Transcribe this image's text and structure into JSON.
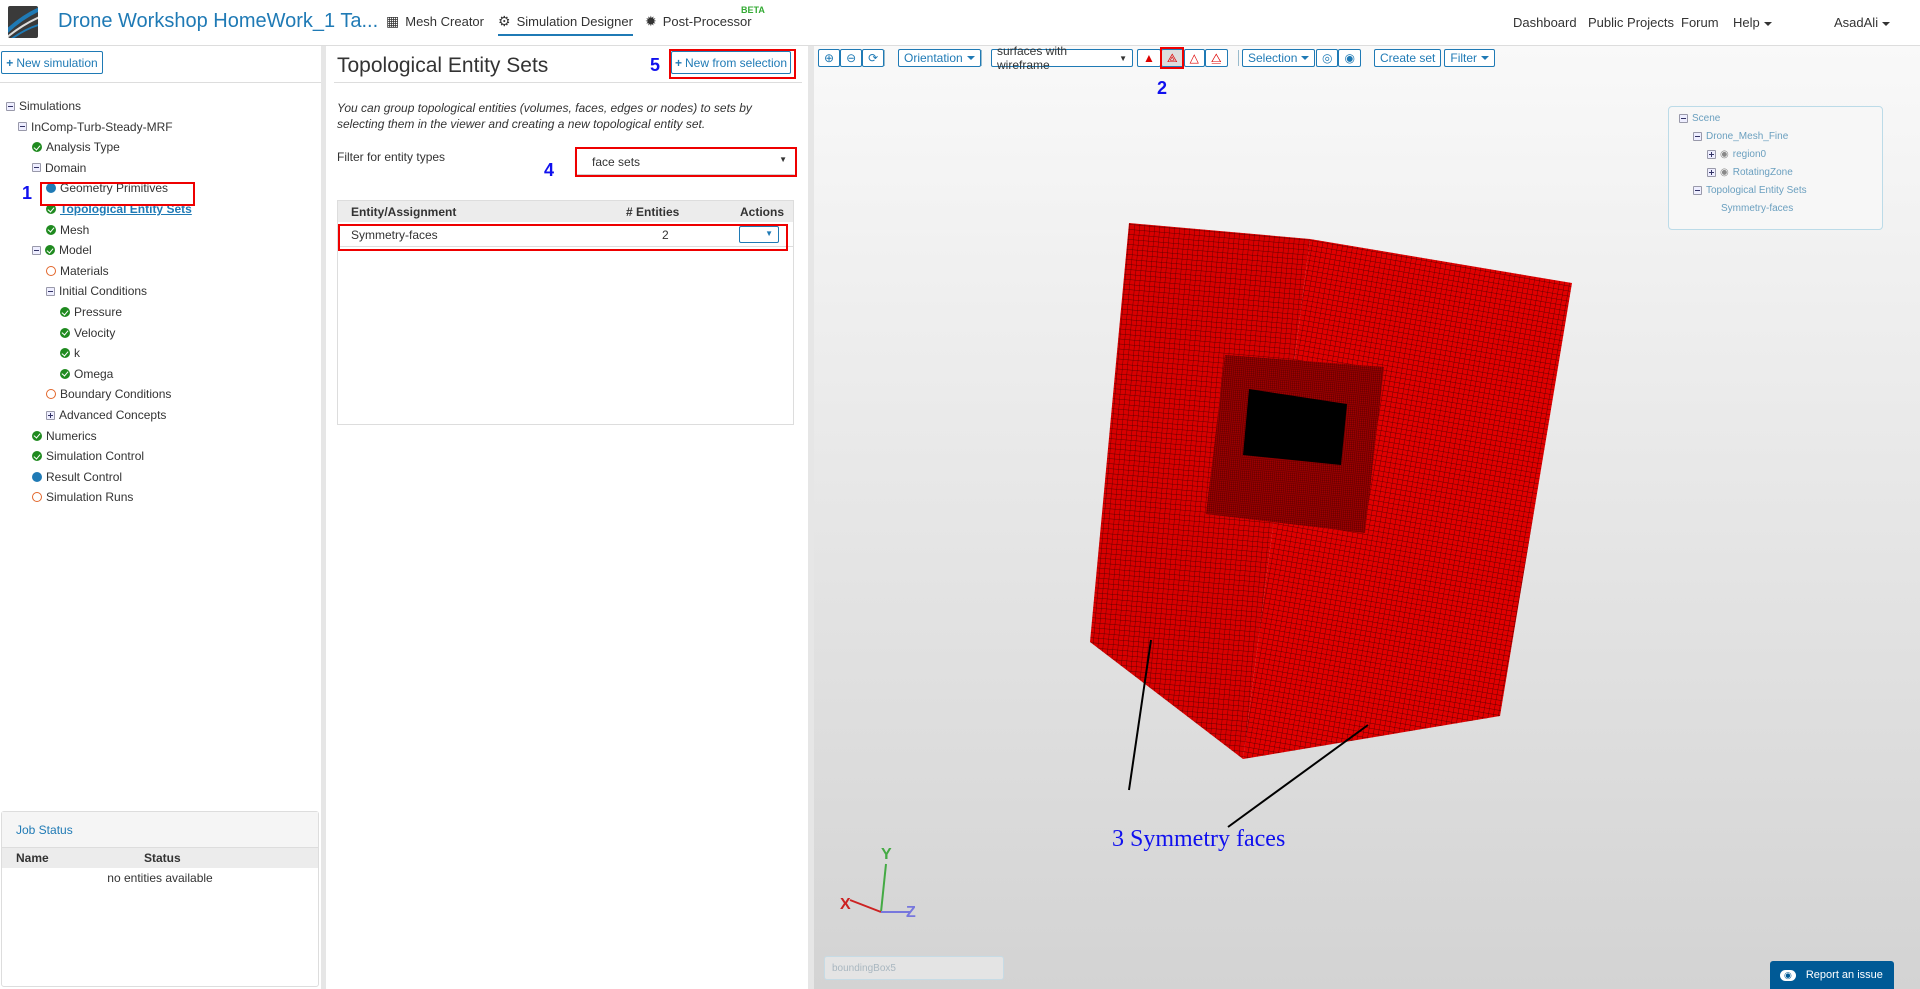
{
  "header": {
    "title": "Drone Workshop HomeWork_1 Ta...",
    "nav": [
      {
        "label": "Mesh Creator",
        "icon": "grid-icon"
      },
      {
        "label": "Simulation Designer",
        "icon": "gears-icon",
        "active": true
      },
      {
        "label": "Post-Processor",
        "icon": "gear-icon",
        "badge": "BETA"
      }
    ],
    "right_nav": [
      {
        "label": "Dashboard"
      },
      {
        "label": "Public Projects"
      },
      {
        "label": "Forum"
      },
      {
        "label": "Help"
      },
      {
        "label": "AsadAli"
      }
    ]
  },
  "sidebar": {
    "new_simulation": "New simulation",
    "tree": [
      {
        "label": "Simulations",
        "depth": 0,
        "icon": "minus"
      },
      {
        "label": "InComp-Turb-Steady-MRF",
        "depth": 1,
        "icon": "minus"
      },
      {
        "label": "Analysis Type",
        "depth": 2,
        "icon": "ok"
      },
      {
        "label": "Domain",
        "depth": 2,
        "icon": "minus"
      },
      {
        "label": "Geometry Primitives",
        "depth": 3,
        "icon": "info"
      },
      {
        "label": "Topological Entity Sets",
        "depth": 3,
        "icon": "ok",
        "selected": true
      },
      {
        "label": "Mesh",
        "depth": 3,
        "icon": "ok"
      },
      {
        "label": "Model",
        "depth": 2,
        "icon": "minus-ok"
      },
      {
        "label": "Materials",
        "depth": 3,
        "icon": "todo"
      },
      {
        "label": "Initial Conditions",
        "depth": 3,
        "icon": "minus"
      },
      {
        "label": "Pressure",
        "depth": 4,
        "icon": "ok"
      },
      {
        "label": "Velocity",
        "depth": 4,
        "icon": "ok"
      },
      {
        "label": "k",
        "depth": 4,
        "icon": "ok"
      },
      {
        "label": "Omega",
        "depth": 4,
        "icon": "ok"
      },
      {
        "label": "Boundary Conditions",
        "depth": 3,
        "icon": "todo"
      },
      {
        "label": "Advanced Concepts",
        "depth": 3,
        "icon": "plus"
      },
      {
        "label": "Numerics",
        "depth": 2,
        "icon": "ok"
      },
      {
        "label": "Simulation Control",
        "depth": 2,
        "icon": "ok"
      },
      {
        "label": "Result Control",
        "depth": 2,
        "icon": "info"
      },
      {
        "label": "Simulation Runs",
        "depth": 2,
        "icon": "todo"
      }
    ],
    "job_status": {
      "title": "Job Status",
      "columns": [
        "Name",
        "Status"
      ],
      "empty": "no entities available"
    }
  },
  "panel": {
    "title": "Topological Entity Sets",
    "new_from_selection": "New from selection",
    "description": "You can group topological entities (volumes, faces, edges or nodes) to sets by selecting them in the viewer and creating a new topological entity set.",
    "filter_label": "Filter for entity types",
    "filter_value": "face sets",
    "table": {
      "columns": [
        "Entity/Assignment",
        "# Entities",
        "Actions"
      ],
      "rows": [
        {
          "name": "Symmetry-faces",
          "count": "2"
        }
      ]
    }
  },
  "viewer": {
    "toolbar": {
      "orientation": "Orientation",
      "render_mode": "surfaces with wireframe",
      "selection": "Selection",
      "create_set": "Create set",
      "filter": "Filter"
    },
    "scene_tree": [
      {
        "label": "Scene",
        "depth": 0
      },
      {
        "label": "Drone_Mesh_Fine",
        "depth": 1
      },
      {
        "label": "region0",
        "depth": 2,
        "eye": true
      },
      {
        "label": "RotatingZone",
        "depth": 2,
        "eye": true
      },
      {
        "label": "Topological Entity Sets",
        "depth": 1
      },
      {
        "label": "Symmetry-faces",
        "depth": 3
      }
    ],
    "axes": {
      "x": "X",
      "y": "Y",
      "z": "Z"
    },
    "bbox_placeholder": "boundingBox5",
    "report_issue": "Report an issue",
    "mesh_color": "#e00000"
  },
  "annotations": {
    "a1": "1",
    "a2": "2",
    "a3": "3  Symmetry  faces",
    "a4": "4",
    "a5": "5"
  }
}
